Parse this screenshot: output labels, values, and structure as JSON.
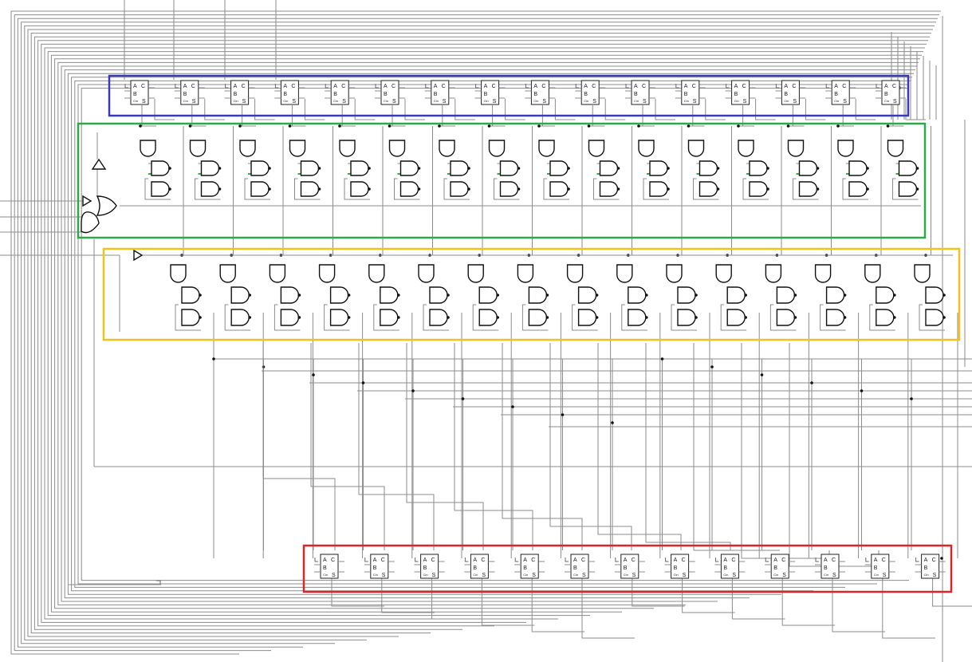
{
  "colors": {
    "top_adder_box": "#3a3ab8",
    "green_latch_box": "#2fa84a",
    "yellow_latch_box": "#f2c21a",
    "bottom_adder_box": "#d9262b",
    "wire": "#8c8c8c",
    "gate_stroke": "#111111",
    "feedback_accent": "#3da84a"
  },
  "adder": {
    "port_a": "A",
    "port_b": "B",
    "port_c": "C",
    "port_s": "S",
    "port_cin": "Cin"
  },
  "top_adder_row": {
    "count": 16
  },
  "green_latch_row": {
    "count": 16
  },
  "yellow_latch_row": {
    "count": 16
  },
  "bottom_adder_row": {
    "count": 13
  }
}
